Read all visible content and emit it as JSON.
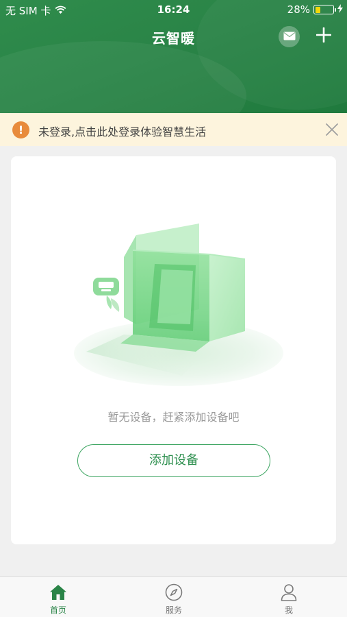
{
  "status_bar": {
    "carrier": "无 SIM 卡",
    "time": "16:24",
    "battery": "28%",
    "battery_level": 0.28
  },
  "header": {
    "title": "云智暖",
    "mail_icon": "mail-icon",
    "add_icon": "plus-icon"
  },
  "login_banner": {
    "icon": "warning-icon",
    "text": "未登录,点击此处登录体验智慧生活",
    "close_icon": "close-icon"
  },
  "empty_state": {
    "illustration": "empty-box-illustration",
    "message": "暂无设备，赶紧添加设备吧",
    "button_label": "添加设备"
  },
  "tabbar": {
    "items": [
      {
        "label": "首页",
        "icon": "home-icon",
        "active": true
      },
      {
        "label": "服务",
        "icon": "compass-icon",
        "active": false
      },
      {
        "label": "我",
        "icon": "person-icon",
        "active": false
      }
    ]
  },
  "colors": {
    "brand_green": "#2a8447",
    "warning_orange": "#e88b3c",
    "banner_bg": "#fdf4dd"
  }
}
